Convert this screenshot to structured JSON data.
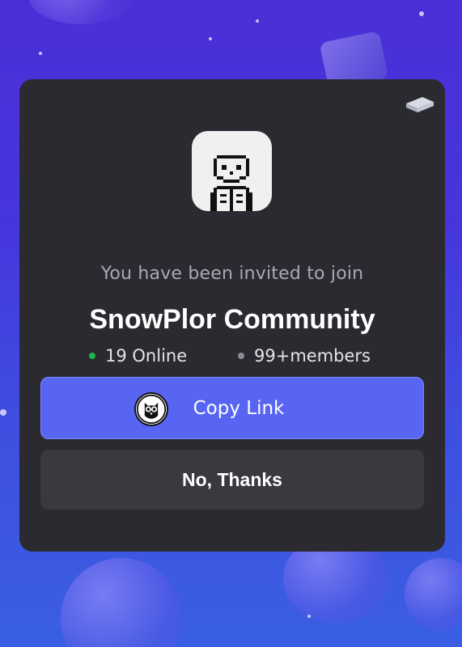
{
  "invite": {
    "subtitle": "You have been invited to join",
    "server_name": "SnowPlor Community",
    "online_count": "19 Online",
    "members_count": "99+members"
  },
  "actions": {
    "copy_link_label": "Copy Link",
    "decline_label": "No, Thanks"
  },
  "colors": {
    "primary_button": "#5865f2",
    "card_background": "#2b2a31",
    "online_dot": "#22b14c"
  },
  "icons": {
    "server_avatar": "pixel-skeleton-icon",
    "copy_link": "owl-icon",
    "corner": "cube-icon"
  }
}
